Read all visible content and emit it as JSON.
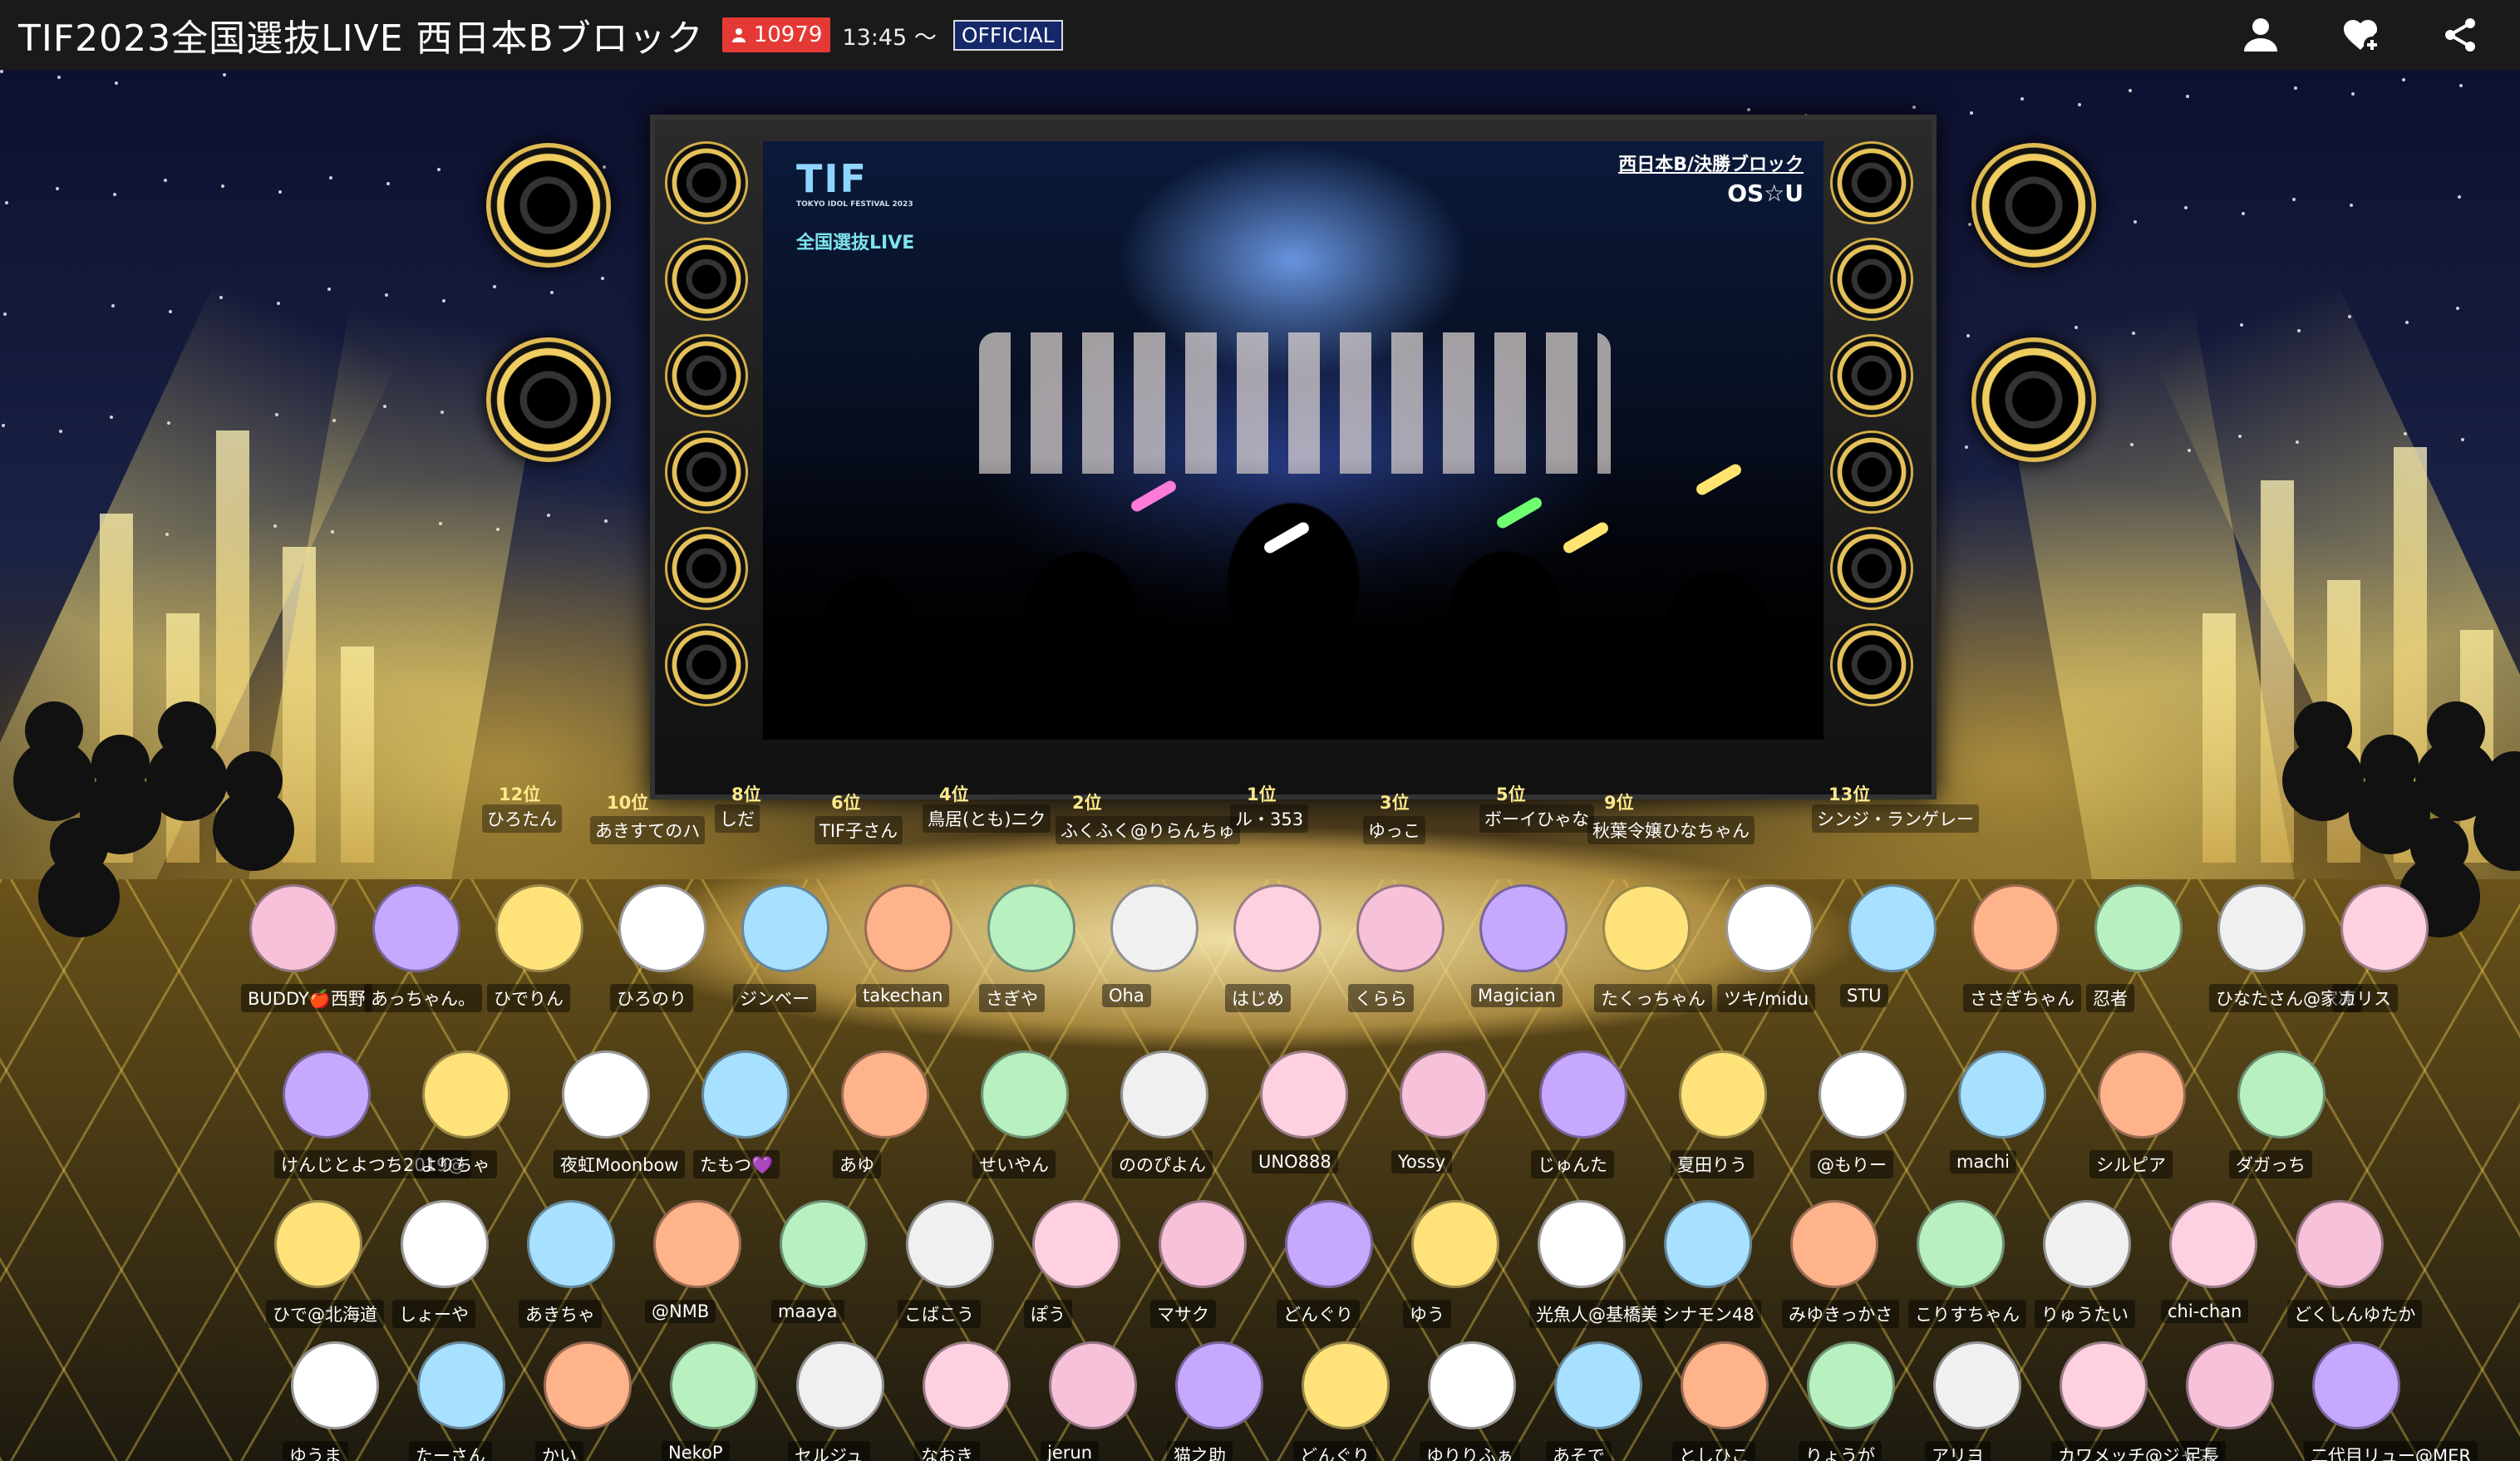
{
  "header": {
    "title": "TIF2023全国選抜LIVE 西日本Bブロック",
    "viewer_count": "10979",
    "start_time": "13:45 ～",
    "official_badge": "OFFICIAL",
    "accent_color": "#e53935"
  },
  "top_actions": [
    {
      "name": "profile-icon"
    },
    {
      "name": "favorite-add-icon"
    },
    {
      "name": "share-icon"
    }
  ],
  "video": {
    "logo_text": "TIF",
    "logo_sub": "TOKYO IDOL FESTIVAL 2023",
    "live_label": "全国選抜LIVE",
    "block_label": "西日本B/決勝ブロック",
    "group_name": "OS☆U"
  },
  "ranks": [
    {
      "rank": "12位",
      "user": "ひろたん"
    },
    {
      "rank": "10位",
      "user": "あきすてのハ"
    },
    {
      "rank": "8位",
      "user": "しだ"
    },
    {
      "rank": "6位",
      "user": "TIF子さん"
    },
    {
      "rank": "4位",
      "user": "鳥居(とも)ニク"
    },
    {
      "rank": "2位",
      "user": "ふくふく@りらんちゅ"
    },
    {
      "rank": "1位",
      "user": "ル・353"
    },
    {
      "rank": "3位",
      "user": "ゆっこ"
    },
    {
      "rank": "5位",
      "user": "ボーイひゃな"
    },
    {
      "rank": "9位",
      "user": "秋葉令嬢ひなちゃん"
    },
    {
      "rank": "13位",
      "user": "シンジ・ランゲレー"
    }
  ],
  "audience_row1": [
    "BUDDY🍎西野",
    "あっちゃん。",
    "ひでりん",
    "ひろのり",
    "ジンベー",
    "takechan",
    "さぎや",
    "Oha",
    "はじめ",
    "くらら",
    "Magician",
    "たくっちゃん",
    "ツキ/midu",
    "STU",
    "ささぎちゃん",
    "忍者",
    "ひなたさん@家凍",
    "カリス"
  ],
  "audience_row2": [
    "けんじとよつち2019@",
    "よりちゃ",
    "夜虹Moonbow",
    "たもつ💜",
    "あゆ",
    "せいやん",
    "ののぴよん",
    "UNO888",
    "Yossy",
    "じゅんた",
    "夏田りう",
    "@もりー",
    "machi",
    "シルピア",
    "ダガっち"
  ],
  "audience_row3": [
    "ひで@北海道",
    "しょーや",
    "あきちゃ",
    "@NMB",
    "maaya",
    "こばこう",
    "ぽう",
    "マサク",
    "どんぐり",
    "ゆう",
    "光魚人@基橋美",
    "シナモン48",
    "みゆきっかさ",
    "こりすちゃん",
    "りゅうたい",
    "chi-chan",
    "どくしんゆたか"
  ],
  "audience_row4": [
    "ゆうま",
    "たーさん",
    "かい",
    "NekoP",
    "セルジュ",
    "なおき",
    "jerun",
    "猫之助",
    "どんぐり",
    "ゆりりふぁ",
    "あそで",
    "としひこ",
    "りょうが",
    "アリヨ",
    "カワメッチ@ジャス",
    "足長",
    "二代目リュー@MER"
  ]
}
